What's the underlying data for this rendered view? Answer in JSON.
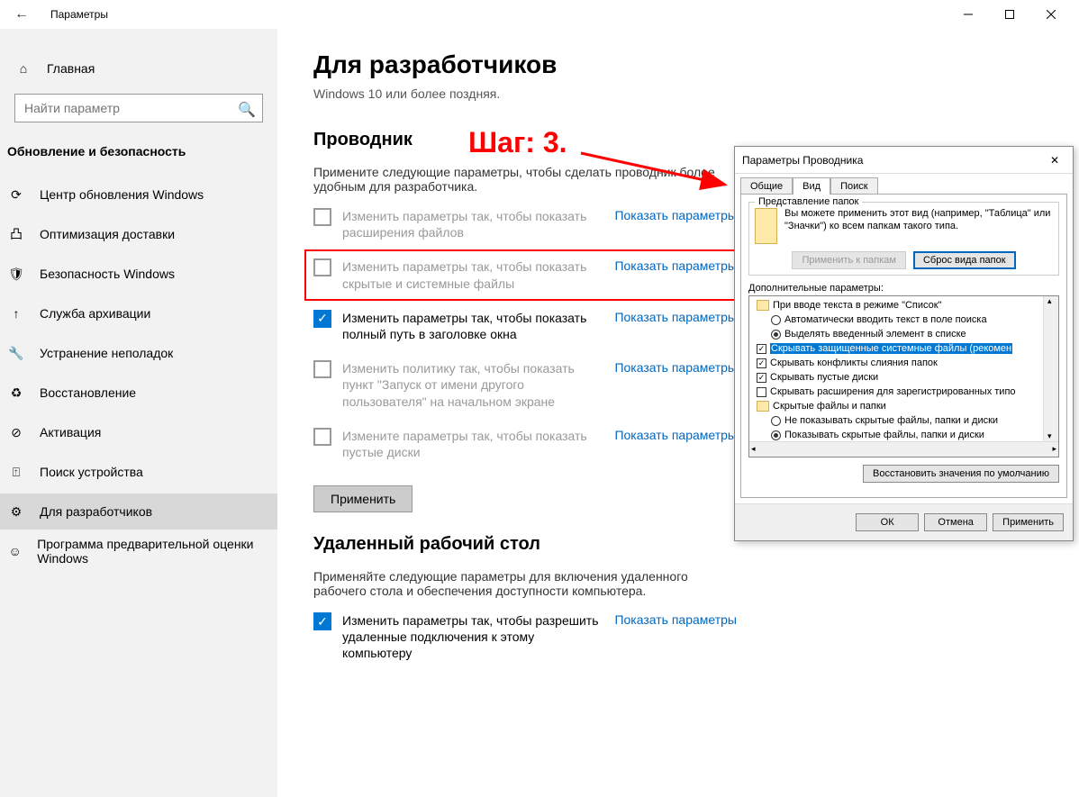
{
  "titlebar": {
    "title": "Параметры"
  },
  "sidebar": {
    "home": "Главная",
    "search_placeholder": "Найти параметр",
    "category": "Обновление и безопасность",
    "items": [
      "Центр обновления Windows",
      "Оптимизация доставки",
      "Безопасность Windows",
      "Служба архивации",
      "Устранение неполадок",
      "Восстановление",
      "Активация",
      "Поиск устройства",
      "Для разработчиков",
      "Программа предварительной оценки Windows"
    ]
  },
  "main": {
    "h1": "Для разработчиков",
    "sub": "Windows 10 или более поздняя.",
    "explorer_h": "Проводник",
    "explorer_desc": "Примените следующие параметры, чтобы сделать проводник более удобным для разработчика.",
    "show": "Показать параметры",
    "items": [
      "Изменить параметры так, чтобы показать расширения файлов",
      "Изменить параметры так, чтобы показать скрытые и системные файлы",
      "Изменить параметры так, чтобы показать полный путь в заголовке окна",
      "Изменить политику так, чтобы показать пункт \"Запуск от имени другого пользователя\" на начальном экране",
      "Измените параметры так, чтобы показать пустые диски"
    ],
    "apply": "Применить",
    "remote_h": "Удаленный рабочий стол",
    "remote_desc": "Применяйте следующие параметры для включения удаленного рабочего стола и обеспечения доступности компьютера.",
    "remote_item": "Изменить параметры так, чтобы разрешить удаленные подключения к этому компьютеру"
  },
  "annotation": "Шаг: 3.",
  "dialog": {
    "title": "Параметры Проводника",
    "tabs": [
      "Общие",
      "Вид",
      "Поиск"
    ],
    "grp_title": "Представление папок",
    "grp_text": "Вы можете применить этот вид (например, \"Таблица\" или \"Значки\") ко всем папкам такого типа.",
    "btn_apply_folders": "Применить к папкам",
    "btn_reset_folders": "Сброс вида папок",
    "adv_label": "Дополнительные параметры:",
    "tree": {
      "n0": "При вводе текста в режиме \"Список\"",
      "n0a": "Автоматически вводить текст в поле поиска",
      "n0b": "Выделять введенный элемент в списке",
      "n1": "Скрывать защищенные системные файлы (рекомен",
      "n2": "Скрывать конфликты слияния папок",
      "n3": "Скрывать пустые диски",
      "n4": "Скрывать расширения для зарегистрированных типо",
      "n5": "Скрытые файлы и папки",
      "n5a": "Не показывать скрытые файлы, папки и диски",
      "n5b": "Показывать скрытые файлы, папки и диски"
    },
    "btn_restore": "Восстановить значения по умолчанию",
    "btn_ok": "ОК",
    "btn_cancel": "Отмена",
    "btn_apply": "Применить"
  }
}
